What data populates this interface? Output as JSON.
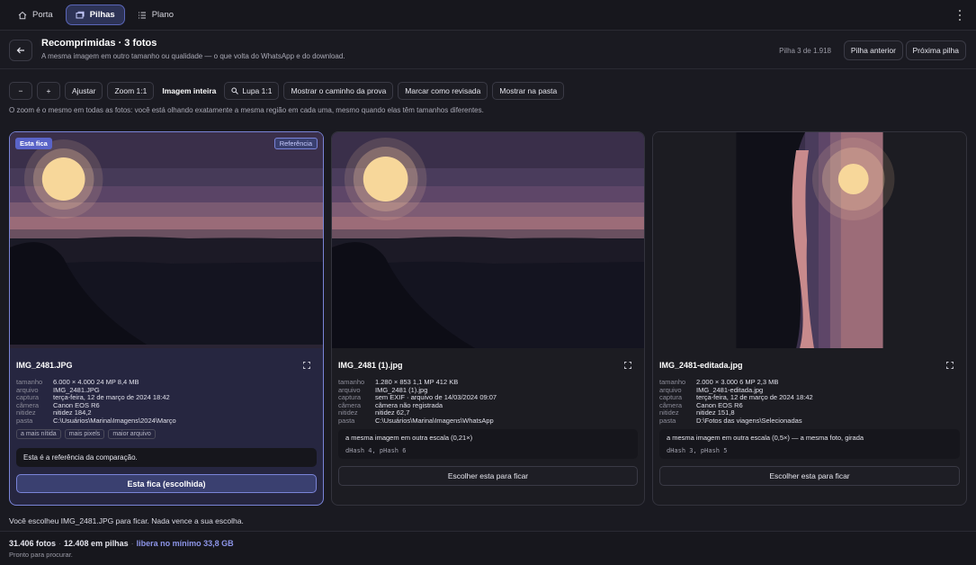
{
  "nav": {
    "items": [
      {
        "label": "Porta",
        "icon": "home-icon"
      },
      {
        "label": "Pilhas",
        "icon": "stack-icon"
      },
      {
        "label": "Plano",
        "icon": "list-icon"
      }
    ],
    "active": "Pilhas"
  },
  "header": {
    "title": "Recomprimidas · 3 fotos",
    "subtitle": "A mesma imagem em outro tamanho ou qualidade — o que volta do WhatsApp e do download.",
    "counter": "Pilha 3 de 1.918",
    "prev_label": "Pilha anterior",
    "next_label": "Próxima pilha"
  },
  "toolbar": {
    "minus": "−",
    "plus": "+",
    "fit": "Ajustar",
    "zoom": "Zoom 1:1",
    "whole": "Imagem inteira",
    "loupe": "Lupa 1:1",
    "proof": "Mostrar o caminho da prova",
    "reviewed": "Marcar como revisada",
    "folder": "Mostrar na pasta",
    "note": "O zoom é o mesmo em todas as fotos: você está olhando exatamente a mesma região em cada uma, mesmo quando elas têm tamanhos diferentes."
  },
  "meta_labels": {
    "size": "tamanho",
    "file": "arquivo",
    "capture": "captura",
    "camera": "câmera",
    "sharpness": "nitidez",
    "folder": "pasta"
  },
  "cards": [
    {
      "badge_left": "Esta fica",
      "badge_right": "Referência",
      "name": "IMG_2481.JPG",
      "size": "6.000 × 4.000 24 MP 8,4 MB",
      "file": "IMG_2481.JPG",
      "capture": "terça-feira, 12 de março de 2024 18:42",
      "camera": "Canon EOS R6",
      "sharpness": "nitidez 184,2",
      "folder": "C:\\Usuários\\Marina\\Imagens\\2024\\Março",
      "tags": [
        "a mais nítida",
        "mais pixels",
        "maior arquivo"
      ],
      "note": "Esta é a referência da comparação.",
      "button": "Esta fica (escolhida)"
    },
    {
      "name": "IMG_2481 (1).jpg",
      "size": "1.280 × 853 1,1 MP 412 KB",
      "file": "IMG_2481 (1).jpg",
      "capture": "sem EXIF · arquivo de 14/03/2024 09:07",
      "camera": "câmera não registrada",
      "sharpness": "nitidez 62,7",
      "folder": "C:\\Usuários\\Marina\\Imagens\\WhatsApp",
      "relation": "a mesma imagem em outra escala (0,21×)",
      "hash": "dHash 4, pHash 6",
      "button": "Escolher esta para ficar"
    },
    {
      "name": "IMG_2481-editada.jpg",
      "size": "2.000 × 3.000 6 MP 2,3 MB",
      "file": "IMG_2481-editada.jpg",
      "capture": "terça-feira, 12 de março de 2024 18:42",
      "camera": "Canon EOS R6",
      "sharpness": "nitidez 151,8",
      "folder": "D:\\Fotos das viagens\\Selecionadas",
      "relation": "a mesma imagem em outra escala (0,5×) — a mesma foto, girada",
      "hash": "dHash 3, pHash 5",
      "button": "Escolher esta para ficar"
    }
  ],
  "status": "Você escolheu IMG_2481.JPG para ficar. Nada vence a sua escolha.",
  "footer": {
    "photos": "31.406 fotos",
    "stacks": "12.408 em pilhas",
    "frees": "libera no mínimo 33,8 GB",
    "ready": "Pronto para procurar."
  },
  "colors": {
    "accent": "#7a84d8",
    "background": "#1a1a21",
    "sun": "#f7d79a"
  }
}
